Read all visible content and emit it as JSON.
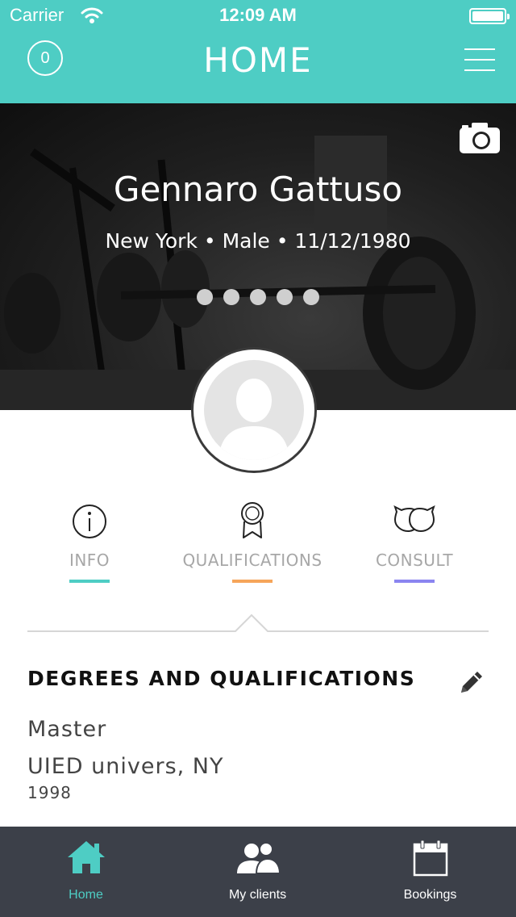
{
  "status_bar": {
    "carrier": "Carrier",
    "time": "12:09 AM"
  },
  "header": {
    "badge_count": "0",
    "title": "HOME"
  },
  "profile": {
    "name": "Gennaro Gattuso",
    "details": "New York • Male • 11/12/1980",
    "carousel_pages": 5
  },
  "tabs": [
    {
      "label": "INFO",
      "accent": "#4ecdc4"
    },
    {
      "label": "QUALIFICATIONS",
      "accent": "#f6a55a"
    },
    {
      "label": "CONSULT",
      "accent": "#8b85f0"
    }
  ],
  "section": {
    "title": "DEGREES AND QUALIFICATIONS",
    "degree": "Master",
    "school": "UIED univers, NY",
    "year": "1998"
  },
  "bottom_nav": [
    {
      "label": "Home",
      "active": true
    },
    {
      "label": "My clients",
      "active": false
    },
    {
      "label": "Bookings",
      "active": false
    }
  ],
  "colors": {
    "primary": "#4ecdc4",
    "nav_bg": "#3c4049"
  }
}
